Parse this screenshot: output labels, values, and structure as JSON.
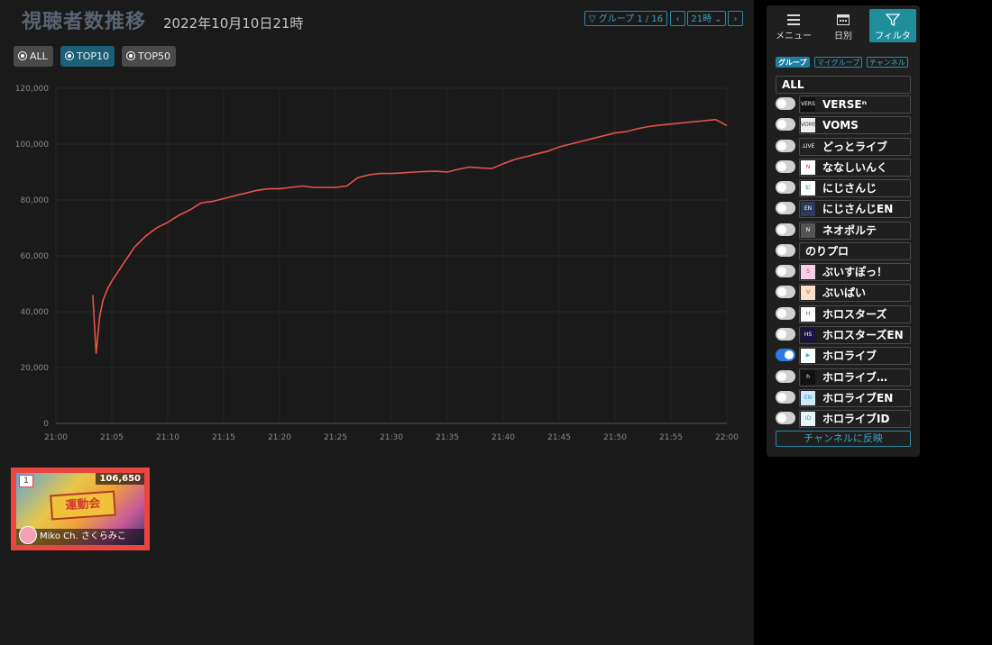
{
  "header": {
    "title": "視聴者数推移",
    "datetime": "2022年10月10日21時",
    "group_nav": "グループ 1 / 16",
    "hour_nav": "21時"
  },
  "filters": [
    {
      "label": "ALL",
      "active": false
    },
    {
      "label": "TOP10",
      "active": true
    },
    {
      "label": "TOP50",
      "active": false
    }
  ],
  "chart_data": {
    "type": "line",
    "xlabel": "",
    "ylabel": "",
    "x_ticks": [
      "21:00",
      "21:05",
      "21:10",
      "21:15",
      "21:20",
      "21:25",
      "21:30",
      "21:35",
      "21:40",
      "21:45",
      "21:50",
      "21:55",
      "22:00"
    ],
    "y_ticks": [
      "0",
      "20,000",
      "40,000",
      "60,000",
      "80,000",
      "100,000",
      "120,000"
    ],
    "ylim": [
      0,
      120000
    ],
    "xlim_minutes": [
      0,
      60
    ],
    "grid": true,
    "series": [
      {
        "color": "#e5534b",
        "x": [
          3.3,
          3.6,
          3.9,
          4.2,
          4.6,
          5.0,
          5.5,
          6.0,
          6.5,
          7.0,
          7.5,
          8.0,
          8.5,
          9.0,
          10,
          11,
          12,
          13,
          14,
          15,
          16,
          17,
          18,
          19,
          20,
          21,
          22,
          23,
          24,
          25,
          26,
          27,
          28,
          29,
          30,
          31,
          32,
          33,
          34,
          35,
          36,
          37,
          38,
          39,
          40,
          41,
          42,
          43,
          44,
          45,
          46,
          47,
          48,
          49,
          50,
          51,
          52,
          53,
          54,
          55,
          56,
          57,
          58,
          59,
          60
        ],
        "y": [
          46000,
          25000,
          38000,
          44000,
          48000,
          51000,
          54000,
          57000,
          60000,
          63000,
          65000,
          67000,
          68500,
          70000,
          72000,
          74500,
          76500,
          79000,
          79500,
          80500,
          81500,
          82500,
          83500,
          84000,
          84000,
          84500,
          85000,
          84500,
          84500,
          84500,
          85000,
          88000,
          89000,
          89500,
          89500,
          89700,
          90000,
          90200,
          90300,
          90000,
          91000,
          91800,
          91500,
          91300,
          93000,
          94500,
          95500,
          96500,
          97500,
          99000,
          100000,
          101000,
          102000,
          103000,
          104000,
          104500,
          105500,
          106300,
          106800,
          107200,
          107600,
          108000,
          108400,
          108800,
          106650
        ]
      }
    ]
  },
  "card": {
    "rank": "1",
    "viewers": "106,650",
    "channel": "Miko Ch. さくらみこ",
    "art_text": "運動会"
  },
  "panel": {
    "menu": "メニュー",
    "daily": "日別",
    "filter": "フィルタ",
    "tabs": [
      "グループ",
      "マイグループ",
      "チャンネル"
    ],
    "all_label": "ALL",
    "groups": [
      {
        "name": "VERSEⁿ",
        "icon": "VERSE",
        "on": false
      },
      {
        "name": "VOMS",
        "icon": "VOMS",
        "on": false
      },
      {
        "name": "どっとライブ",
        "icon": ".LIVE",
        "on": false
      },
      {
        "name": "ななしいんく",
        "icon": "N",
        "on": false
      },
      {
        "name": "にじさんじ",
        "icon": "虹",
        "on": false
      },
      {
        "name": "にじさんじEN",
        "icon": "EN",
        "on": false
      },
      {
        "name": "ネオポルテ",
        "icon": "N",
        "on": false
      },
      {
        "name": "のりプロ",
        "icon": "",
        "on": false
      },
      {
        "name": "ぶいすぽっ！",
        "icon": "S",
        "on": false
      },
      {
        "name": "ぶいぱい",
        "icon": "V",
        "on": false
      },
      {
        "name": "ホロスターズ",
        "icon": "H",
        "on": false
      },
      {
        "name": "ホロスターズEN",
        "icon": "HS",
        "on": false
      },
      {
        "name": "ホロライブ",
        "icon": "▶",
        "on": true
      },
      {
        "name": "ホロライブ…",
        "icon": "h",
        "on": false
      },
      {
        "name": "ホロライブEN",
        "icon": "EN",
        "on": false
      },
      {
        "name": "ホロライブID",
        "icon": "ID",
        "on": false
      }
    ],
    "reflect": "チャンネルに反映"
  }
}
